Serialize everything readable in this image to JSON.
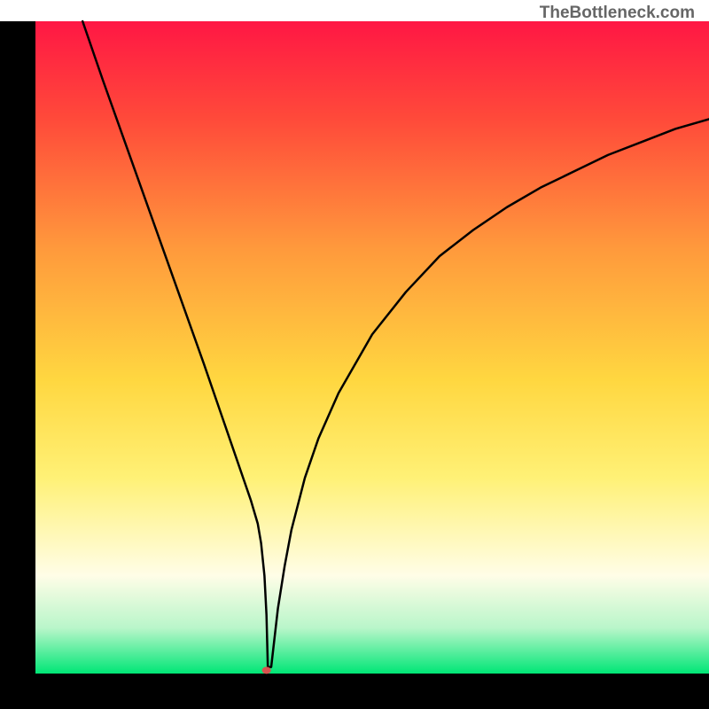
{
  "watermark": "TheBottleneck.com",
  "chart_data": {
    "type": "line",
    "title": "",
    "xlabel": "",
    "ylabel": "",
    "xlim": [
      0,
      100
    ],
    "ylim": [
      0,
      100
    ],
    "background": {
      "type": "vertical-gradient",
      "stops": [
        {
          "offset": 0,
          "color": "#ff1744"
        },
        {
          "offset": 15,
          "color": "#ff4a3a"
        },
        {
          "offset": 35,
          "color": "#ff9a3c"
        },
        {
          "offset": 55,
          "color": "#ffd740"
        },
        {
          "offset": 70,
          "color": "#fff176"
        },
        {
          "offset": 85,
          "color": "#fffde7"
        },
        {
          "offset": 93,
          "color": "#b9f6ca"
        },
        {
          "offset": 100,
          "color": "#00e676"
        }
      ]
    },
    "axes": {
      "show_ticks": false,
      "color": "#000000",
      "thickness": 40
    },
    "curve": {
      "color": "#000000",
      "thickness": 2.5,
      "x": [
        7,
        10,
        15,
        20,
        25,
        28,
        30,
        31,
        32,
        33,
        33.5,
        34,
        34.3,
        34.5,
        35,
        36,
        37,
        38,
        40,
        42,
        45,
        50,
        55,
        60,
        65,
        70,
        75,
        80,
        85,
        90,
        95,
        100
      ],
      "y": [
        100,
        91,
        76.5,
        62,
        47.5,
        38.5,
        32.5,
        29.5,
        26.5,
        23,
        20,
        15,
        9,
        1,
        1,
        10,
        16.5,
        22,
        30,
        36,
        43,
        52,
        58.5,
        64,
        68,
        71.5,
        74.5,
        77,
        79.5,
        81.5,
        83.5,
        85
      ]
    },
    "marker": {
      "x": 34.3,
      "y": 0.5,
      "color": "#d9534f",
      "rx": 5,
      "ry": 4
    }
  }
}
